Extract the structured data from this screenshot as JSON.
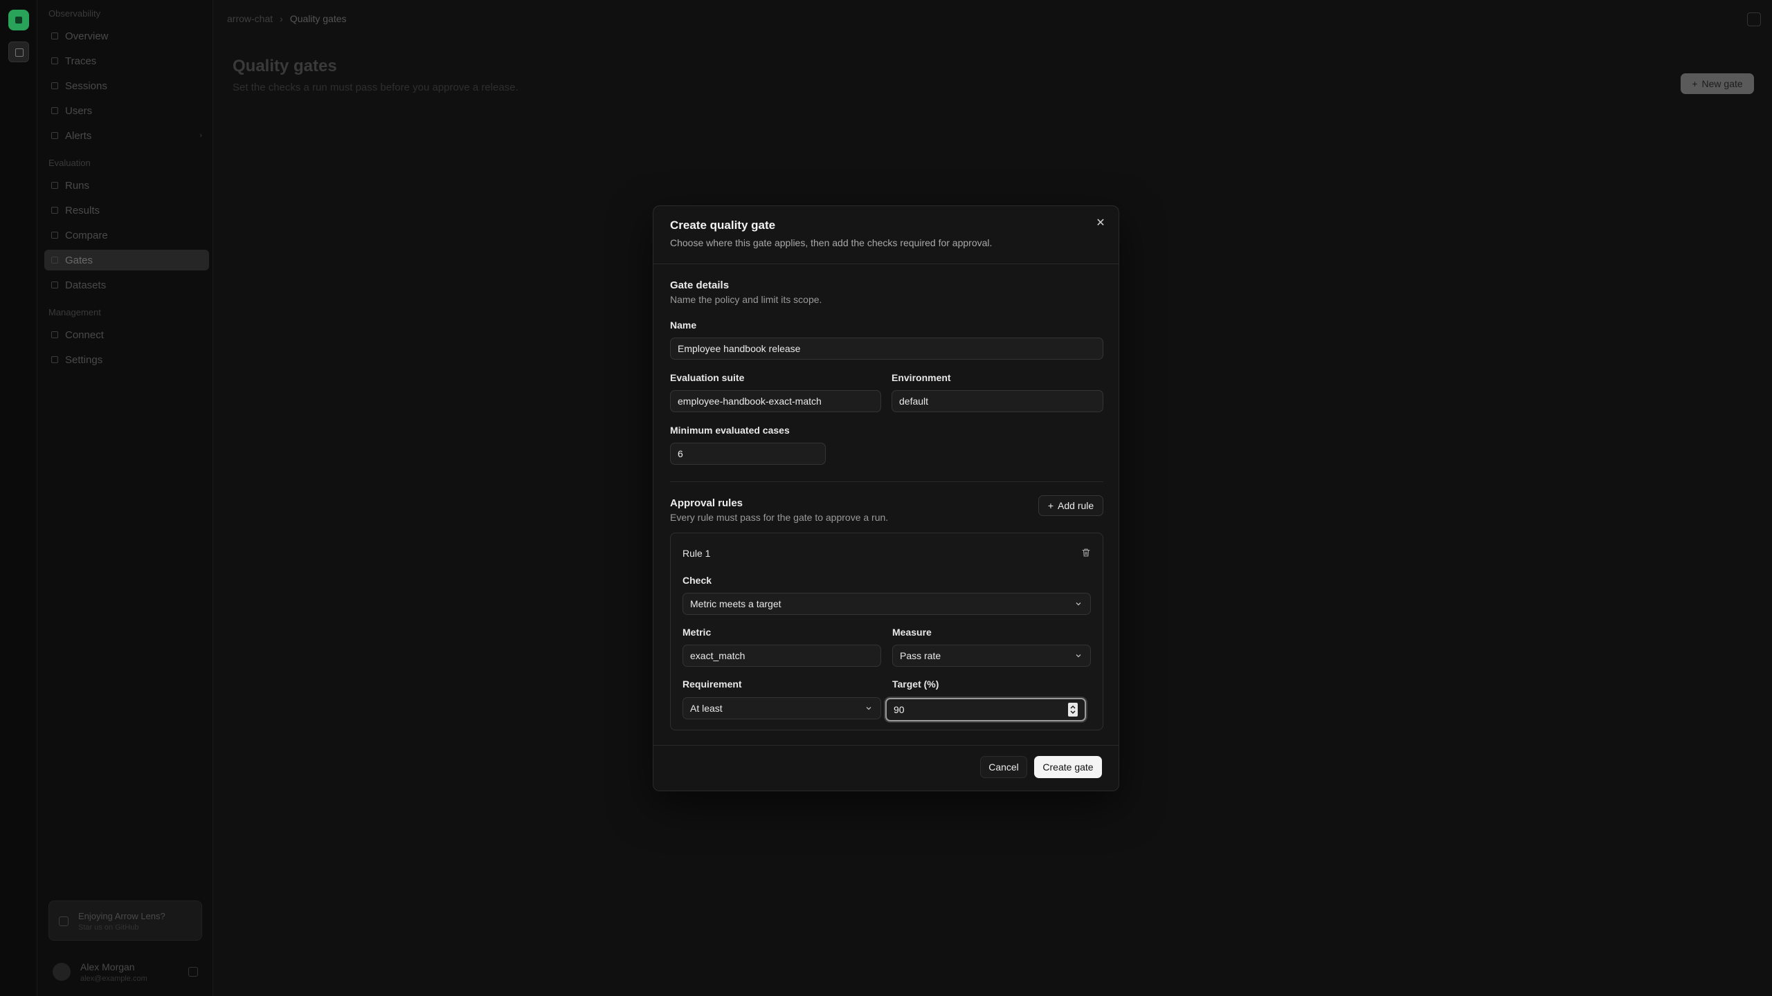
{
  "sidebar": {
    "section1": "Observability",
    "items1": [
      "Overview",
      "Traces",
      "Sessions",
      "Users",
      "Alerts"
    ],
    "section2": "Evaluation",
    "items2": [
      "Runs",
      "Results",
      "Compare",
      "Gates",
      "Datasets"
    ],
    "section3": "Management",
    "items3": [
      "Connect",
      "Settings"
    ],
    "promo_title": "Enjoying Arrow Lens?",
    "promo_sub": "Star us on GitHub",
    "user_name": "Alex Morgan",
    "user_email": "alex@example.com"
  },
  "header": {
    "crumb1": "arrow-chat",
    "crumb_sep": "›",
    "crumb2": "Quality gates",
    "title": "Quality gates",
    "subtitle": "Set the checks a run must pass before you approve a release.",
    "new_gate": "New gate",
    "new_gate_icon": "+"
  },
  "modal": {
    "title": "Create quality gate",
    "description": "Choose where this gate applies, then add the checks required for approval.",
    "close_icon": "✕",
    "details_title": "Gate details",
    "details_desc": "Name the policy and limit its scope.",
    "name_label": "Name",
    "name_value": "Employee handbook release",
    "suite_label": "Evaluation suite",
    "suite_value": "employee-handbook-exact-match",
    "env_label": "Environment",
    "env_value": "default",
    "min_cases_label": "Minimum evaluated cases",
    "min_cases_value": "6",
    "rules_title": "Approval rules",
    "rules_desc": "Every rule must pass for the gate to approve a run.",
    "add_rule_icon": "+",
    "add_rule": "Add rule",
    "rule": {
      "title": "Rule 1",
      "check_label": "Check",
      "check_value": "Metric meets a target",
      "metric_label": "Metric",
      "metric_value": "exact_match",
      "measure_label": "Measure",
      "measure_value": "Pass rate",
      "requirement_label": "Requirement",
      "requirement_value": "At least",
      "target_label": "Target (%)",
      "target_value": "90"
    },
    "cancel": "Cancel",
    "create": "Create gate"
  }
}
